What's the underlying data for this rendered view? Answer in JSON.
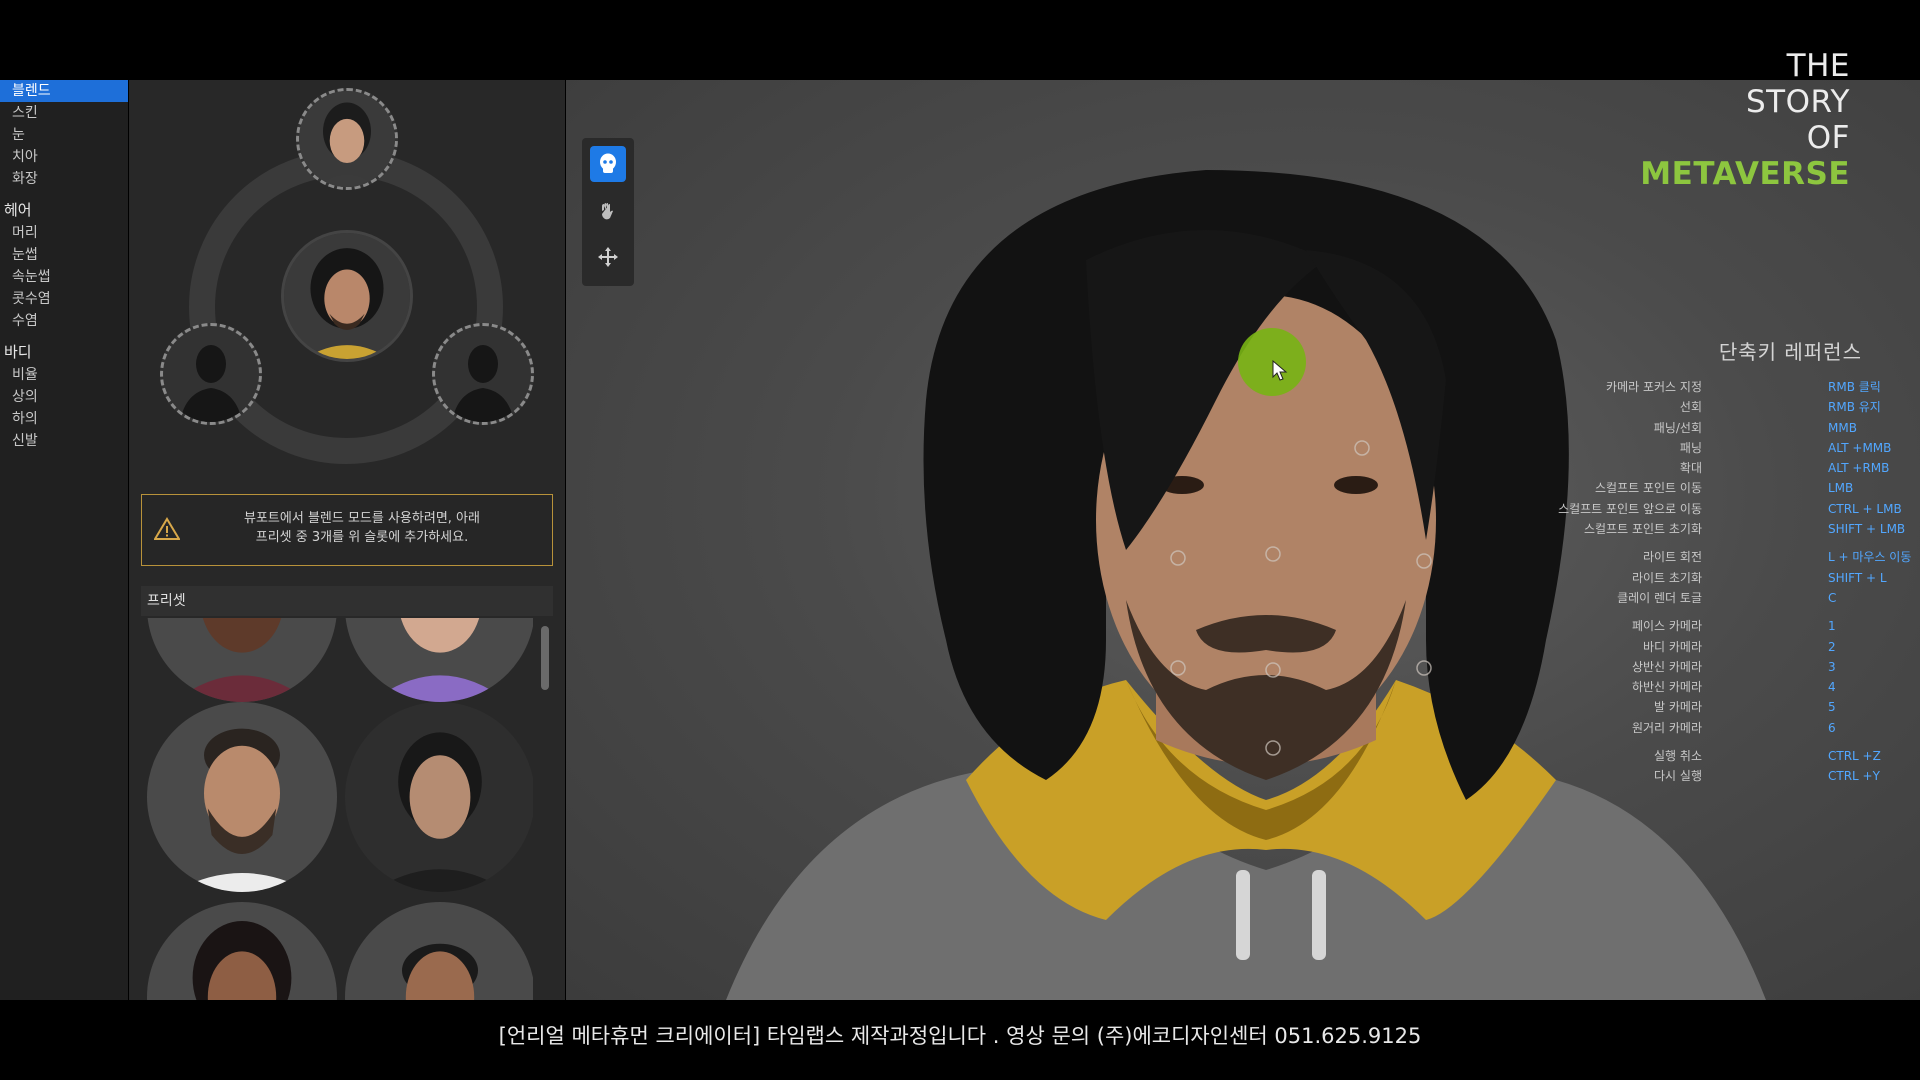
{
  "nav": {
    "sections": [
      {
        "items": [
          "블렌드",
          "스킨",
          "눈",
          "치아",
          "화장"
        ],
        "active": "블렌드"
      },
      {
        "title": "헤어",
        "items": [
          "머리",
          "눈썹",
          "속눈썹",
          "콧수염",
          "수염"
        ]
      },
      {
        "title": "바디",
        "items": [
          "비율",
          "상의",
          "하의",
          "신발"
        ]
      }
    ]
  },
  "warning": {
    "icon": "warning-icon",
    "text": "뷰포트에서 블렌드 모드를 사용하려면, 아래\n프리셋 중 3개를 위 슬롯에 추가하세요."
  },
  "presets": {
    "header": "프리셋"
  },
  "toolbar": {
    "tools": [
      "skull-icon",
      "hand-icon",
      "move-icon"
    ],
    "active_color": "#1e7ae6"
  },
  "brand": {
    "line1": "THE",
    "line2": "STORY",
    "line3": "OF",
    "line4": "METAVERSE",
    "accent_color": "#8dc63f"
  },
  "shortcuts": {
    "title": "단축키 레퍼런스",
    "groups": [
      [
        {
          "label": "카메라 포커스 지정",
          "key": "RMB 클릭"
        },
        {
          "label": "선회",
          "key": "RMB 유지"
        },
        {
          "label": "패닝/선회",
          "key": "MMB"
        },
        {
          "label": "패닝",
          "key": "ALT +MMB"
        },
        {
          "label": "확대",
          "key": "ALT +RMB"
        },
        {
          "label": "스컬프트 포인트 이동",
          "key": "LMB"
        },
        {
          "label": "스컬프트 포인트 앞으로 이동",
          "key": "CTRL + LMB"
        },
        {
          "label": "스컬프트 포인트 초기화",
          "key": "SHIFT + LMB"
        }
      ],
      [
        {
          "label": "라이트 회전",
          "key": "L + 마우스 이동"
        },
        {
          "label": "라이트 초기화",
          "key": "SHIFT + L"
        },
        {
          "label": "클레이 렌더 토글",
          "key": "C"
        }
      ],
      [
        {
          "label": "페이스 카메라",
          "key": "1"
        },
        {
          "label": "바디 카메라",
          "key": "2"
        },
        {
          "label": "상반신 카메라",
          "key": "3"
        },
        {
          "label": "하반신 카메라",
          "key": "4"
        },
        {
          "label": "발 카메라",
          "key": "5"
        },
        {
          "label": "원거리 카메라",
          "key": "6"
        }
      ],
      [
        {
          "label": "실행 취소",
          "key": "CTRL +Z"
        },
        {
          "label": "다시 실행",
          "key": "CTRL +Y"
        }
      ]
    ],
    "key_color": "#52a7ff"
  },
  "subtitle": {
    "text": "[언리얼 메타휴먼 크리에이터] 타임랩스 제작과정입니다 . 영상 문의 (주)에코디자인센터 051.625.9125"
  }
}
